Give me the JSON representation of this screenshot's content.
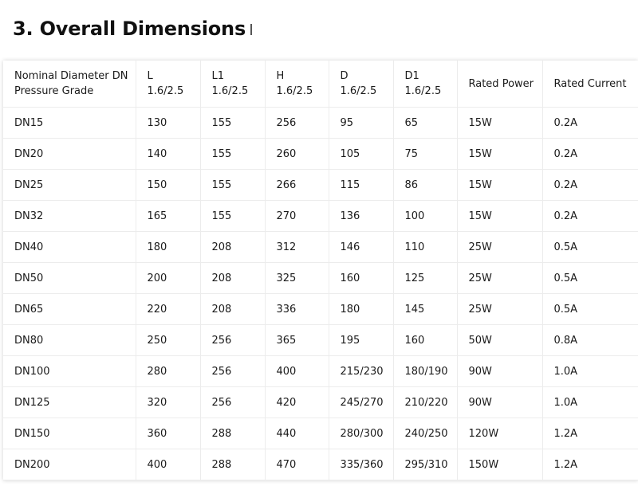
{
  "page": {
    "title": "3. Overall Dimensions"
  },
  "table": {
    "headers": [
      [
        "Nominal Diameter DN",
        "Pressure Grade"
      ],
      [
        "L",
        "1.6/2.5"
      ],
      [
        "L1",
        "1.6/2.5"
      ],
      [
        "H",
        "1.6/2.5"
      ],
      [
        "D",
        "1.6/2.5"
      ],
      [
        "D1",
        "1.6/2.5"
      ],
      [
        "Rated Power"
      ],
      [
        "Rated Current"
      ]
    ],
    "rows": [
      [
        "DN15",
        "130",
        "155",
        "256",
        "95",
        "65",
        "15W",
        "0.2A"
      ],
      [
        "DN20",
        "140",
        "155",
        "260",
        "105",
        "75",
        "15W",
        "0.2A"
      ],
      [
        "DN25",
        "150",
        "155",
        "266",
        "115",
        "86",
        "15W",
        "0.2A"
      ],
      [
        "DN32",
        "165",
        "155",
        "270",
        "136",
        "100",
        "15W",
        "0.2A"
      ],
      [
        "DN40",
        "180",
        "208",
        "312",
        "146",
        "110",
        "25W",
        "0.5A"
      ],
      [
        "DN50",
        "200",
        "208",
        "325",
        "160",
        "125",
        "25W",
        "0.5A"
      ],
      [
        "DN65",
        "220",
        "208",
        "336",
        "180",
        "145",
        "25W",
        "0.5A"
      ],
      [
        "DN80",
        "250",
        "256",
        "365",
        "195",
        "160",
        "50W",
        "0.8A"
      ],
      [
        "DN100",
        "280",
        "256",
        "400",
        "215/230",
        "180/190",
        "90W",
        "1.0A"
      ],
      [
        "DN125",
        "320",
        "256",
        "420",
        "245/270",
        "210/220",
        "90W",
        "1.0A"
      ],
      [
        "DN150",
        "360",
        "288",
        "440",
        "280/300",
        "240/250",
        "120W",
        "1.2A"
      ],
      [
        "DN200",
        "400",
        "288",
        "470",
        "335/360",
        "295/310",
        "150W",
        "1.2A"
      ]
    ]
  }
}
